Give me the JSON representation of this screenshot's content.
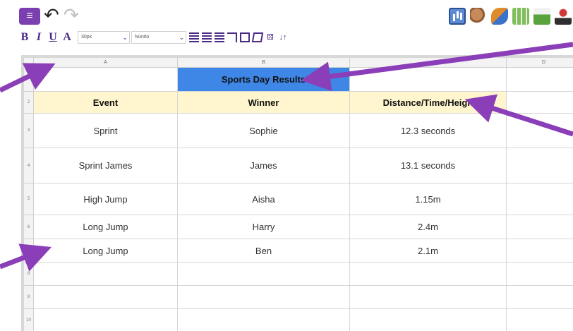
{
  "toolbar": {
    "menu_icon": "hamburger-icon",
    "undo_icon": "undo-icon",
    "redo_icon": "redo-icon",
    "font_size": "30px",
    "font_family": "Nunito",
    "right_tools": [
      "chart-icon",
      "shapes-icon",
      "paint-icon",
      "grid-icon",
      "download-icon",
      "joystick-icon",
      "record-icon"
    ]
  },
  "format": {
    "bold": "B",
    "italic": "I",
    "underline": "U",
    "superscript": "A"
  },
  "sheet": {
    "columns": [
      "A",
      "B",
      "C",
      "D"
    ],
    "title": "Sports Day Results",
    "headers": [
      "Event",
      "Winner",
      "Distance/Time/Heigh"
    ],
    "rows": [
      {
        "num": "1"
      },
      {
        "num": "2"
      },
      {
        "num": "3",
        "event": "Sprint",
        "winner": "Sophie",
        "result": "12.3 seconds"
      },
      {
        "num": "4",
        "event": "Sprint James",
        "winner": "James",
        "result": "13.1 seconds"
      },
      {
        "num": "5",
        "event": "High Jump",
        "winner": "Aisha",
        "result": "1.15m"
      },
      {
        "num": "6",
        "event": "Long Jump",
        "winner": "Harry",
        "result": "2.4m"
      },
      {
        "num": "7",
        "event": "Long Jump",
        "winner": "Ben",
        "result": "2.1m"
      },
      {
        "num": "8"
      },
      {
        "num": "9"
      },
      {
        "num": "10"
      }
    ]
  },
  "colors": {
    "accent": "#7b3fb0",
    "title_fill": "#3f87e6",
    "header_fill": "#fff6cf",
    "arrow": "#8a3fb8"
  }
}
